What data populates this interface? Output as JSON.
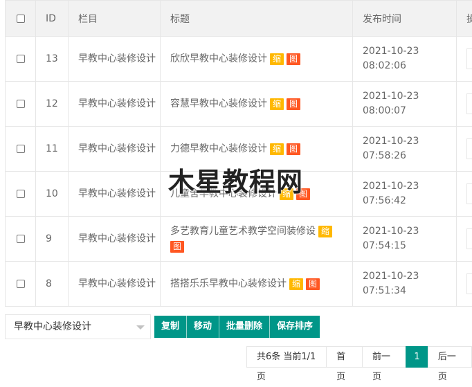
{
  "table": {
    "headers": {
      "id": "ID",
      "category": "栏目",
      "title": "标题",
      "time": "发布时间",
      "action": "操"
    },
    "rows": [
      {
        "id": "13",
        "category": "早教中心装修设计",
        "title": "欣欣早教中心装修设计",
        "time": "2021-10-23 08:02:06"
      },
      {
        "id": "12",
        "category": "早教中心装修设计",
        "title": "容慧早教中心装修设计",
        "time": "2021-10-23 08:00:07"
      },
      {
        "id": "11",
        "category": "早教中心装修设计",
        "title": "力德早教中心装修设计",
        "time": "2021-10-23 07:58:26"
      },
      {
        "id": "10",
        "category": "早教中心装修设计",
        "title": "儿童舍早教中心装修设计",
        "time": "2021-10-23 07:56:42"
      },
      {
        "id": "9",
        "category": "早教中心装修设计",
        "title": "多艺教育儿童艺术教学空间装修设",
        "time": "2021-10-23 07:54:15"
      },
      {
        "id": "8",
        "category": "早教中心装修设计",
        "title": "搭搭乐乐早教中心装修设计",
        "time": "2021-10-23 07:51:34"
      }
    ],
    "tag_thumb": "缩",
    "tag_img": "图"
  },
  "watermark": "木星教程网",
  "select": {
    "value": "早教中心装修设计"
  },
  "buttons": {
    "copy": "复制",
    "move": "移动",
    "batch_delete": "批量删除",
    "save_order": "保存排序"
  },
  "pager": {
    "summary": "共6条 当前1/1页",
    "first": "首页",
    "prev": "前一页",
    "current": "1",
    "next": "后一页"
  },
  "colors": {
    "primary": "#009688",
    "thumb_tag": "#FFB800",
    "img_tag": "#FF5722"
  }
}
